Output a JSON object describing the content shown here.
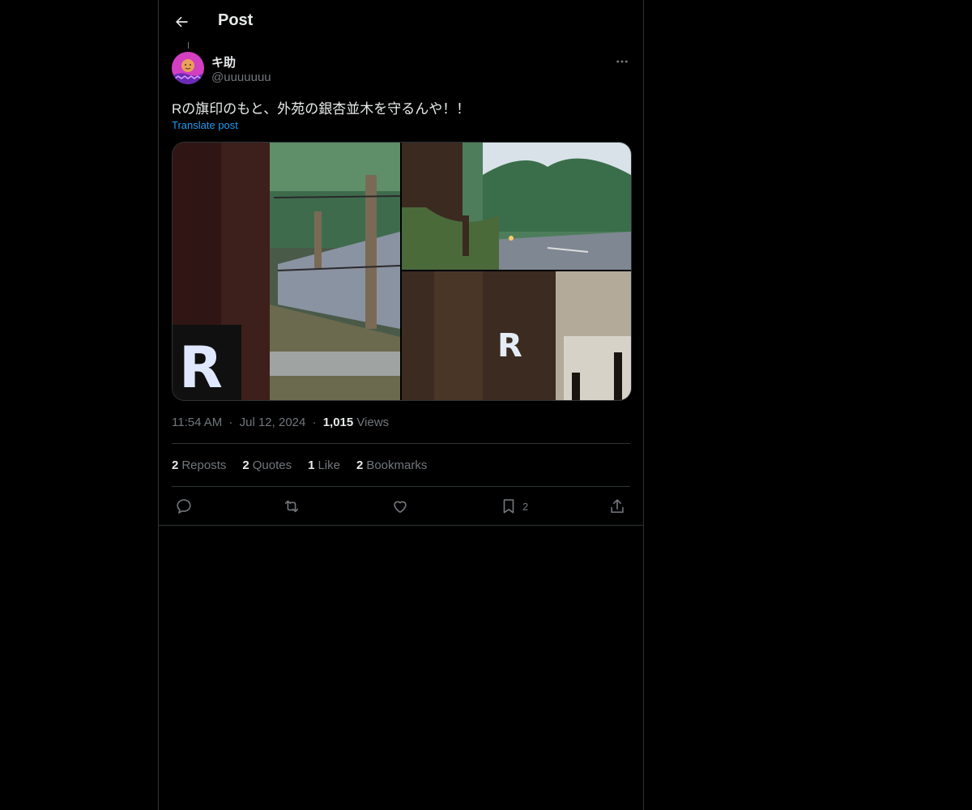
{
  "header": {
    "title": "Post",
    "back_icon": "arrow-left-icon"
  },
  "author": {
    "name": "キ助",
    "handle": "@uuuuuuu",
    "avatar_icon": "avatar-image"
  },
  "post": {
    "text": "Rの旗印のもと、外苑の銀杏並木を守るんや！！",
    "translate_label": "Translate post",
    "media": [
      {
        "name": "image-r-sticker-on-pole"
      },
      {
        "name": "image-ginkgo-avenue"
      },
      {
        "name": "image-r-sticker-closeup"
      }
    ]
  },
  "meta": {
    "time": "11:54 AM",
    "dot1": "·",
    "date": "Jul 12, 2024",
    "dot2": "·",
    "views_count": "1,015",
    "views_label": "Views"
  },
  "stats": [
    {
      "count": "2",
      "label": "Reposts"
    },
    {
      "count": "2",
      "label": "Quotes"
    },
    {
      "count": "1",
      "label": "Like"
    },
    {
      "count": "2",
      "label": "Bookmarks"
    }
  ],
  "actions": {
    "reply_icon": "reply-icon",
    "repost_icon": "repost-icon",
    "like_icon": "heart-icon",
    "bookmark_icon": "bookmark-icon",
    "bookmark_count": "2",
    "share_icon": "share-icon"
  },
  "colors": {
    "background": "#000000",
    "text": "#e7e9ea",
    "muted": "#71767b",
    "link": "#1d9bf0",
    "border": "#2f3336"
  }
}
